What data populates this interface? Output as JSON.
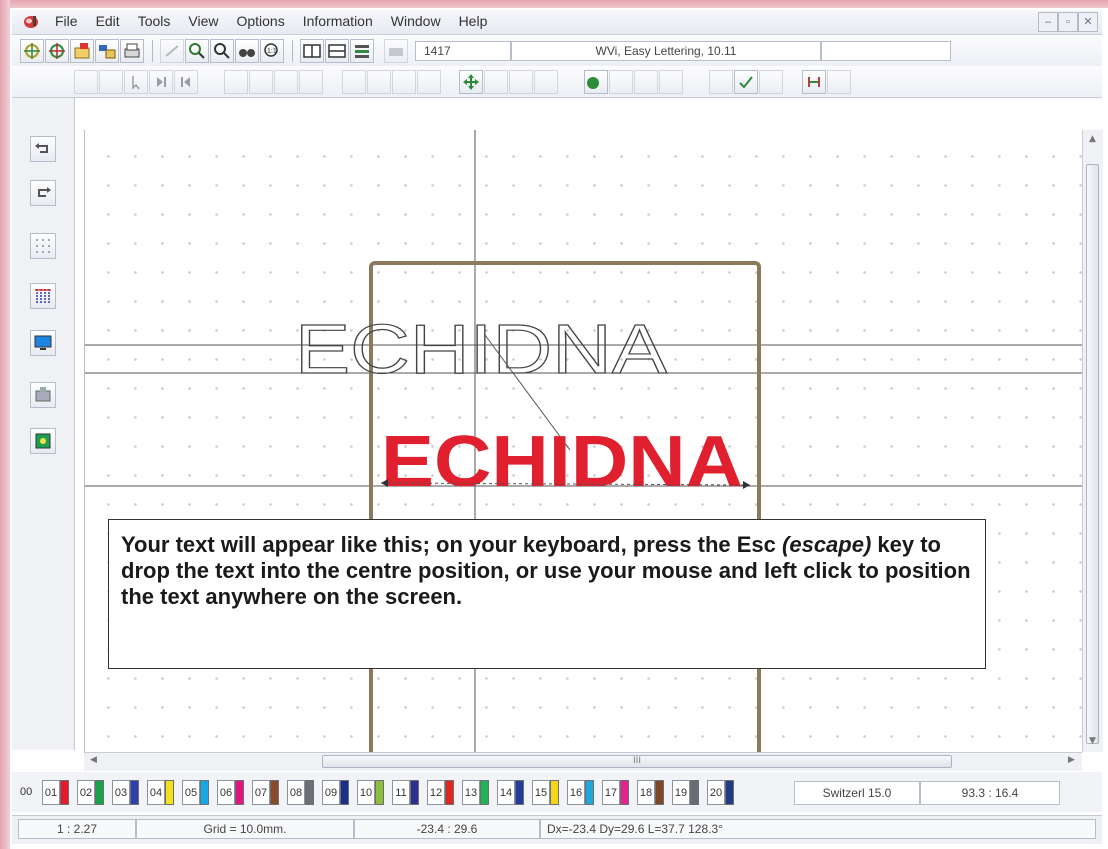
{
  "menu": [
    "File",
    "Edit",
    "Tools",
    "View",
    "Options",
    "Information",
    "Window",
    "Help"
  ],
  "toolbar": {
    "stitch_count": "1417",
    "app_info": "WVi, Easy Lettering, 10.11"
  },
  "canvas": {
    "outline_text": "ECHIDNA",
    "filled_text": "ECHIDNA",
    "colors": {
      "filled_text": "#e0202e",
      "hoop": "#8c7a5e",
      "guide": "#555555"
    }
  },
  "instruction": {
    "part1": "Your text will appear like this; on your keyboard, press the Esc ",
    "emphasis": "(escape)",
    "part2": " key to drop the text into the centre position, or use your mouse and left click to position the text anywhere on the screen."
  },
  "scrollbar": {
    "grip": "III"
  },
  "color_bar": {
    "first_label": "00",
    "swatches": [
      {
        "label": "01",
        "color": "#e8192c"
      },
      {
        "label": "02",
        "color": "#19a24a"
      },
      {
        "label": "03",
        "color": "#2d3fa8"
      },
      {
        "label": "04",
        "color": "#f3e21a"
      },
      {
        "label": "05",
        "color": "#18a9e2"
      },
      {
        "label": "06",
        "color": "#e5157d"
      },
      {
        "label": "07",
        "color": "#8a4a2a"
      },
      {
        "label": "08",
        "color": "#6d6f72"
      },
      {
        "label": "09",
        "color": "#1c2f88"
      },
      {
        "label": "10",
        "color": "#8dbf3a"
      },
      {
        "label": "11",
        "color": "#2b2f8d"
      },
      {
        "label": "12",
        "color": "#e0261f"
      },
      {
        "label": "13",
        "color": "#23b357"
      },
      {
        "label": "14",
        "color": "#233c9a"
      },
      {
        "label": "15",
        "color": "#f5d717"
      },
      {
        "label": "16",
        "color": "#1fa8d8"
      },
      {
        "label": "17",
        "color": "#e2248a"
      },
      {
        "label": "18",
        "color": "#7e4726"
      },
      {
        "label": "19",
        "color": "#6a6c70"
      },
      {
        "label": "20",
        "color": "#243a86"
      }
    ],
    "font": "Switzerl 15.0",
    "size": "93.3 : 16.4"
  },
  "status": {
    "zoom": "1 : 2.27",
    "grid": "Grid = 10.0mm.",
    "coords": "-23.4 : 29.6",
    "measure": "Dx=-23.4 Dy=29.6 L=37.7 128.3°"
  }
}
